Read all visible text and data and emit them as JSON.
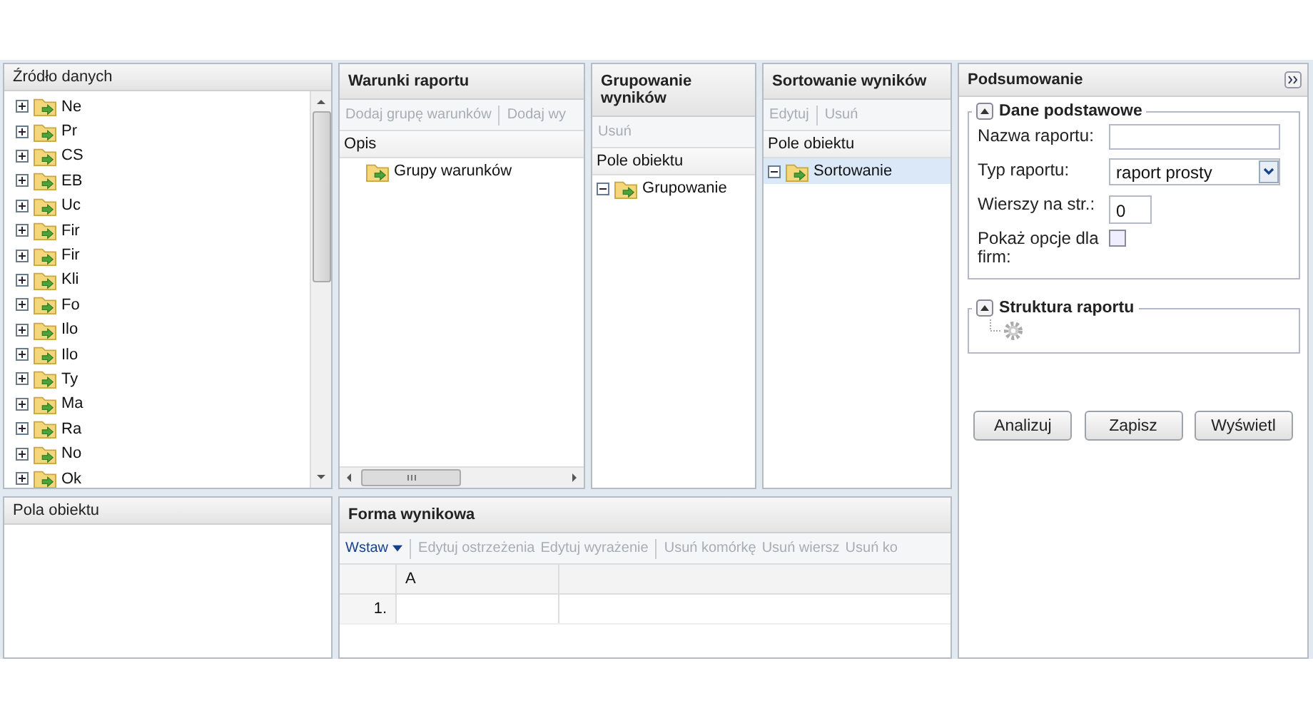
{
  "source_panel": {
    "title": "Źródło danych",
    "items": [
      {
        "label": "Ne",
        "expanded": false
      },
      {
        "label": "Pr",
        "expanded": false
      },
      {
        "label": "CS",
        "expanded": false
      },
      {
        "label": "EB",
        "expanded": false
      },
      {
        "label": "Uc",
        "expanded": false
      },
      {
        "label": "Fir",
        "expanded": false
      },
      {
        "label": "Fir",
        "expanded": false
      },
      {
        "label": "Kli",
        "expanded": false
      },
      {
        "label": "Fo",
        "expanded": false
      },
      {
        "label": "Ilo",
        "expanded": false
      },
      {
        "label": "Ilo",
        "expanded": false
      },
      {
        "label": "Ty",
        "expanded": false
      },
      {
        "label": "Ma",
        "expanded": false
      },
      {
        "label": "Ra",
        "expanded": false
      },
      {
        "label": "No",
        "expanded": false
      },
      {
        "label": "Ok",
        "expanded": false
      }
    ]
  },
  "fields_panel": {
    "title": "Pola obiektu"
  },
  "conditions_panel": {
    "title": "Warunki raportu",
    "toolbar": [
      {
        "kind": "button",
        "label": "Dodaj grupę warunków",
        "disabled": true
      },
      {
        "kind": "separator"
      },
      {
        "kind": "button",
        "label": "Dodaj wy",
        "disabled": true
      }
    ],
    "column": "Opis",
    "items": [
      {
        "label": "Grupy warunków"
      }
    ]
  },
  "grouping_panel": {
    "title": "Grupowanie wyników",
    "toolbar": [
      {
        "kind": "button",
        "label": "Usuń",
        "disabled": true
      }
    ],
    "column": "Pole obiektu",
    "items": [
      {
        "label": "Grupowanie",
        "expanded": true,
        "selected": false
      }
    ]
  },
  "sorting_panel": {
    "title": "Sortowanie wyników",
    "toolbar": [
      {
        "kind": "button",
        "label": "Edytuj",
        "disabled": true
      },
      {
        "kind": "separator"
      },
      {
        "kind": "button",
        "label": "Usuń",
        "disabled": true
      }
    ],
    "column": "Pole obiektu",
    "items": [
      {
        "label": "Sortowanie",
        "expanded": true,
        "selected": true
      }
    ]
  },
  "result_form": {
    "title": "Forma wynikowa",
    "toolbar": [
      {
        "kind": "menu",
        "label": "Wstaw",
        "disabled": false
      },
      {
        "kind": "separator"
      },
      {
        "kind": "button",
        "label": "Edytuj ostrzeżenia",
        "disabled": true
      },
      {
        "kind": "button",
        "label": "Edytuj wyrażenie",
        "disabled": true
      },
      {
        "kind": "separator"
      },
      {
        "kind": "button",
        "label": "Usuń komórkę",
        "disabled": true
      },
      {
        "kind": "button",
        "label": "Usuń wiersz",
        "disabled": true
      },
      {
        "kind": "button",
        "label": "Usuń ko",
        "disabled": true
      }
    ],
    "grid": {
      "columns": [
        "A"
      ],
      "rows": [
        {
          "number": "1."
        }
      ]
    }
  },
  "summary": {
    "title": "Podsumowanie",
    "basic": {
      "title": "Dane podstawowe",
      "expanded": true,
      "fields": [
        {
          "kind": "text",
          "label": "Nazwa raportu:"
        },
        {
          "kind": "select",
          "label": "Typ raportu:",
          "value": "raport prosty"
        },
        {
          "kind": "number",
          "label": "Wierszy na str.:",
          "value": "0"
        },
        {
          "kind": "checkbox",
          "label": "Pokaż opcje dla firm:",
          "checked": false
        }
      ]
    },
    "structure": {
      "title": "Struktura raportu",
      "expanded": true
    },
    "buttons": [
      "Analizuj",
      "Zapisz",
      "Wyświetl"
    ]
  }
}
